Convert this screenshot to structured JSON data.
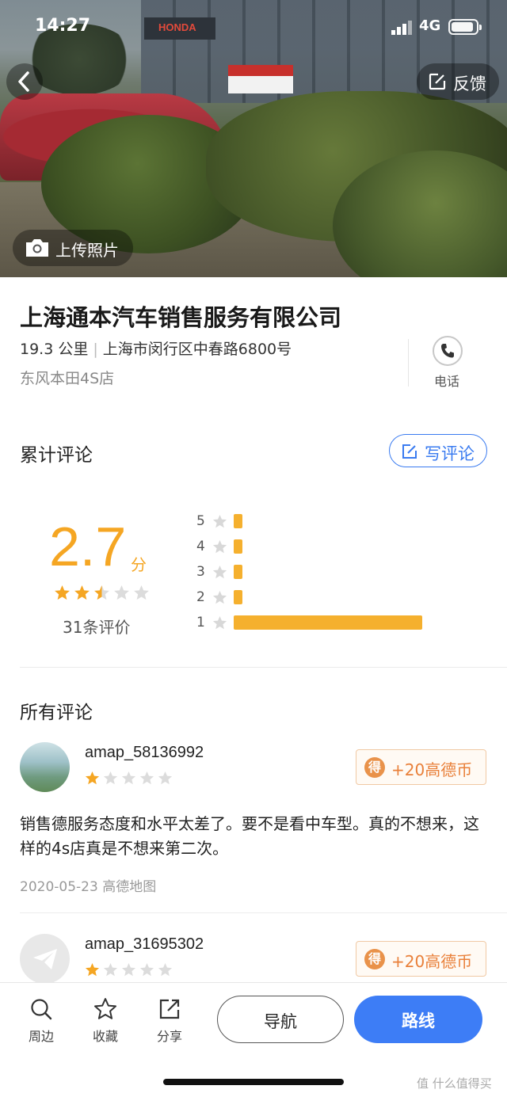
{
  "status_bar": {
    "time": "14:27",
    "network": "4G"
  },
  "hero": {
    "feedback_label": "反馈",
    "upload_label": "上传照片",
    "photo_sign_text": "HONDA"
  },
  "place": {
    "name": "上海通本汽车销售服务有限公司",
    "distance": "19.3 公里",
    "address": "上海市闵行区中春路6800号",
    "category": "东风本田4S店",
    "phone_label": "电话"
  },
  "reviews_summary": {
    "section_title": "累计评论",
    "write_label": "写评论",
    "score": "2.7",
    "score_unit": "分",
    "rating_stars": 2.5,
    "count_text": "31条评价",
    "distribution": [
      {
        "star": "5",
        "share": 0.034
      },
      {
        "star": "4",
        "share": 0.018
      },
      {
        "star": "3",
        "share": 0.018
      },
      {
        "star": "2",
        "share": 0.018
      },
      {
        "star": "1",
        "share": 1.0
      }
    ]
  },
  "all_reviews": {
    "section_title": "所有评论",
    "items": [
      {
        "user": "amap_58136992",
        "stars": 1,
        "reward": "+20高德币",
        "reward_icon": "得",
        "text": "销售德服务态度和水平太差了。要不是看中车型。真的不想来，这样的4s店真是不想来第二次。",
        "meta": "2020-05-23 高德地图"
      },
      {
        "user": "amap_31695302",
        "stars": 1,
        "reward": "+20高德币",
        "reward_icon": "得"
      }
    ]
  },
  "bottom_bar": {
    "nearby": "周边",
    "favorite": "收藏",
    "share": "分享",
    "navigate": "导航",
    "route": "路线"
  },
  "watermark": "值 什么值得买",
  "colors": {
    "accent_blue": "#3d7df6",
    "star_orange": "#f5a623",
    "coin_orange": "#e9803a"
  }
}
